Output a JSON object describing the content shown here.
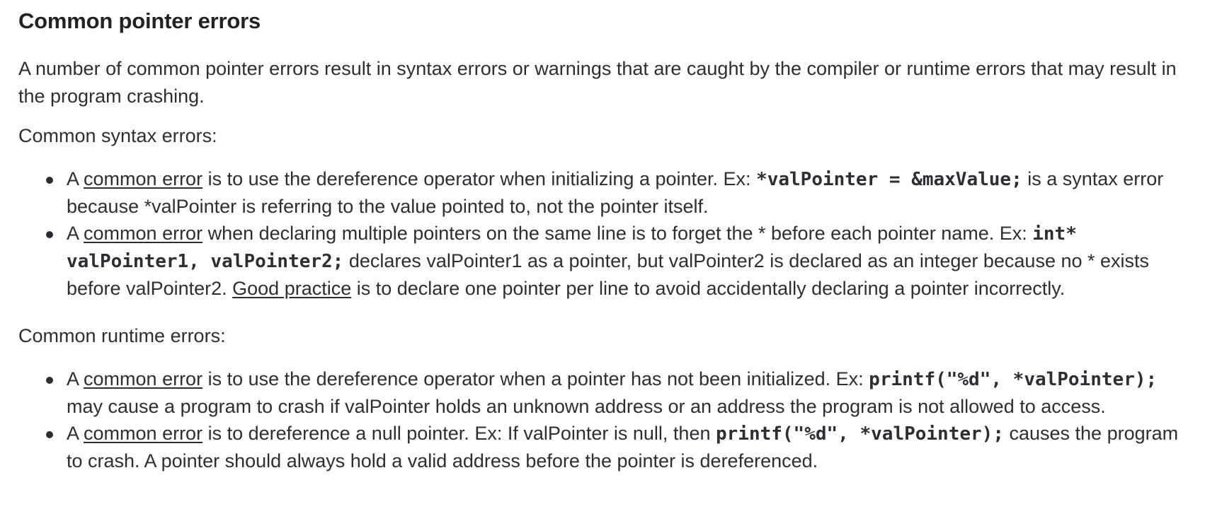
{
  "heading": "Common pointer errors",
  "intro": "A number of common pointer errors result in syntax errors or warnings that are caught by the compiler or runtime errors that may result in the program crashing.",
  "syntax": {
    "lead": "Common syntax errors:",
    "items": [
      {
        "t1": "A ",
        "term": "common error",
        "t2": " is to use the dereference operator when initializing a pointer. Ex: ",
        "code": "*valPointer = &maxValue;",
        "t3": " is a syntax error because *valPointer is referring to the value pointed to, not the pointer itself."
      },
      {
        "t1": "A ",
        "term": "common error",
        "t2": " when declaring multiple pointers on the same line is to forget the * before each pointer name. Ex: ",
        "code": "int* valPointer1, valPointer2;",
        "t3": " declares valPointer1 as a pointer, but valPointer2 is declared as an integer because no * exists before valPointer2. ",
        "term2": "Good practice",
        "t4": " is to declare one pointer per line to avoid accidentally declaring a pointer incorrectly."
      }
    ]
  },
  "runtime": {
    "lead": "Common runtime errors:",
    "items": [
      {
        "t1": "A ",
        "term": "common error",
        "t2": " is to use the dereference operator when a pointer has not been initialized. Ex: ",
        "code": "printf(\"%d\", *valPointer);",
        "t3": " may cause a program to crash if valPointer holds an unknown address or an address the program is not allowed to access."
      },
      {
        "t1": "A ",
        "term": "common error",
        "t2": " is to dereference a null pointer. Ex: If valPointer is null, then ",
        "code": "printf(\"%d\", *valPointer);",
        "t3": " causes the program to crash. A pointer should always hold a valid address before the pointer is dereferenced."
      }
    ]
  }
}
